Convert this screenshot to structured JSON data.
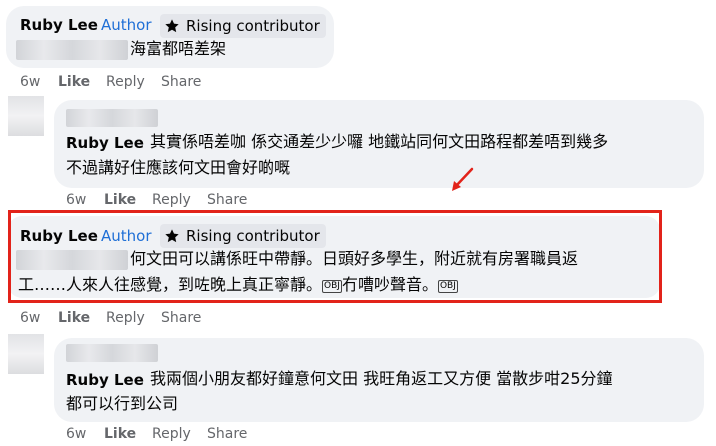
{
  "comments": [
    {
      "name": "Ruby Lee",
      "author_tag": "Author",
      "badge": "Rising contributor",
      "text_line1": "海富都唔差架",
      "actions": {
        "time": "6w",
        "like": "Like",
        "reply": "Reply",
        "share": "Share"
      }
    },
    {
      "name": "Ruby Lee",
      "text_line1": "其實係唔差咖 係交通差少少囉 地鐵站同何文田路程都差唔到幾多",
      "text_line2": "不過講好住應該何文田會好啲嘅",
      "actions": {
        "time": "6w",
        "like": "Like",
        "reply": "Reply",
        "share": "Share"
      }
    },
    {
      "name": "Ruby Lee",
      "author_tag": "Author",
      "badge": "Rising contributor",
      "text_line1": "何文田可以講係旺中帶靜。日頭好多學生，附近就有房署職員返",
      "text_line2a": "工……人來人往感覺，到咗晚上真正寧靜。",
      "obj1": "OBJ",
      "text_line2b": "冇嘈吵聲音。",
      "obj2": "OBJ",
      "actions": {
        "time": "6w",
        "like": "Like",
        "reply": "Reply",
        "share": "Share"
      }
    },
    {
      "name": "Ruby Lee",
      "text_line1": "我兩個小朋友都好鐘意何文田 我旺角返工又方便 當散步咁25分鐘",
      "text_line2": "都可以行到公司",
      "actions": {
        "time": "6w",
        "like": "Like",
        "reply": "Reply",
        "share": "Share"
      }
    }
  ],
  "colors": {
    "highlight": "#e2231a",
    "author": "#1f6fd6",
    "bubble": "#f0f2f5",
    "badge_bg": "#e4e6eb",
    "meta": "#65676b"
  },
  "icons": [
    "star-badge-icon",
    "red-arrow-icon"
  ]
}
